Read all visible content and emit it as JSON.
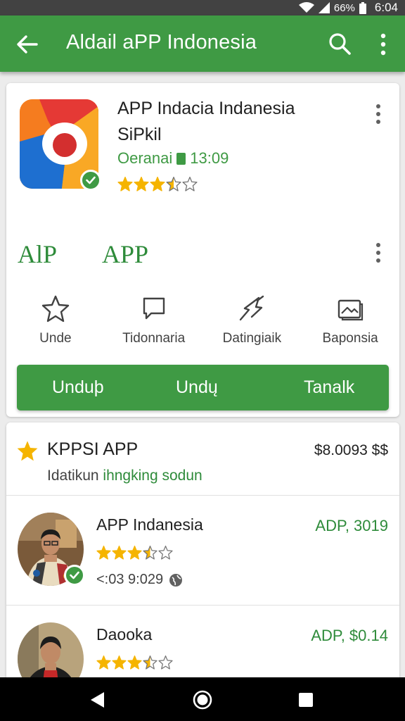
{
  "status_bar": {
    "battery": "66%",
    "time": "6:04"
  },
  "app_bar": {
    "title": "Aldail aPP Indonesia",
    "back_icon": "arrow-back-icon",
    "search_icon": "search-icon",
    "more_icon": "more-vert-icon",
    "color": "#3f9a44"
  },
  "app_card": {
    "name_line1": "APP Indacia Indanesia",
    "name_line2": "SiPkil",
    "meta_label": "Oeranai",
    "meta_time": "13:09",
    "rating": 3.5,
    "label_left": "AlP",
    "label_right": "APP",
    "actions": [
      {
        "label": "Unde",
        "icon": "star-outline-icon"
      },
      {
        "label": "Tidonnaria",
        "icon": "comment-icon"
      },
      {
        "label": "Datingiaik",
        "icon": "share-icon"
      },
      {
        "label": "Baponsia",
        "icon": "photo-icon"
      }
    ],
    "buttons": [
      "Unduþ",
      "Undų",
      "Tanalk"
    ]
  },
  "list_section": {
    "title": "KPPSI APP",
    "price": "$8.0093 $$",
    "subtitle_prefix": "Idatikun",
    "subtitle_highlight": "ihngking sodun",
    "star_color": "#f5b400"
  },
  "rows": [
    {
      "title": "APP Indanesia",
      "price": "ADP, 3019",
      "rating": 3.5,
      "meta": "<:03 9:029",
      "meta_icon": "globe-icon"
    },
    {
      "title": "Daooka",
      "price": "ADP, $0.14",
      "rating": 3.5
    }
  ],
  "nav_bar": {
    "back": "nav-back-icon",
    "home": "nav-home-icon",
    "recents": "nav-recents-icon"
  }
}
